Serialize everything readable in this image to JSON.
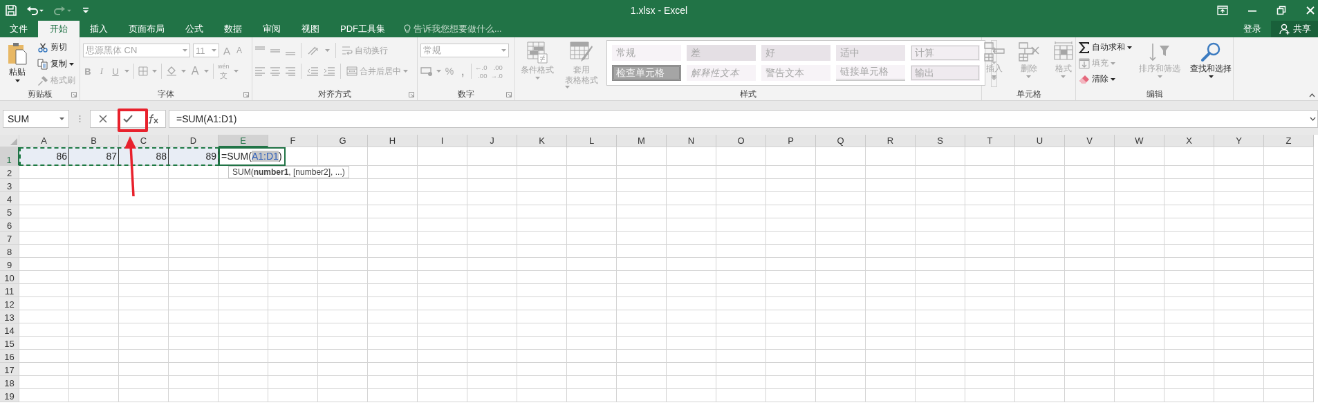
{
  "quick_access": [
    {
      "kind": "save",
      "disabled": false
    },
    {
      "kind": "undo",
      "disabled": false
    },
    {
      "kind": "redo",
      "disabled": true
    },
    {
      "kind": "customize",
      "disabled": false
    }
  ],
  "window": {
    "title": "1.xlsx - Excel"
  },
  "window_controls": [
    {
      "kind": "ribbon-options"
    },
    {
      "kind": "minimize"
    },
    {
      "kind": "restore"
    },
    {
      "kind": "close"
    }
  ],
  "tabs": [
    {
      "label": "文件",
      "selected": false
    },
    {
      "label": "开始",
      "selected": true
    },
    {
      "label": "插入",
      "selected": false
    },
    {
      "label": "页面布局",
      "selected": false
    },
    {
      "label": "公式",
      "selected": false
    },
    {
      "label": "数据",
      "selected": false
    },
    {
      "label": "审阅",
      "selected": false
    },
    {
      "label": "视图",
      "selected": false
    },
    {
      "label": "PDF工具集",
      "selected": false
    }
  ],
  "tell_me": {
    "placeholder": "告诉我您想要做什么..."
  },
  "account": {
    "sign_in": "登录",
    "share": "共享"
  },
  "ribbon": {
    "clipboard": {
      "label": "剪贴板",
      "paste": {
        "label": "粘贴",
        "disabled": false
      },
      "items": [
        {
          "kind": "cut",
          "label": "剪切",
          "disabled": false
        },
        {
          "kind": "copy",
          "label": "复制",
          "disabled": false
        },
        {
          "kind": "format-painter",
          "label": "格式刷",
          "disabled": true
        }
      ]
    },
    "font": {
      "label": "字体",
      "disabled": true,
      "font_name": "思源黑体 CN",
      "font_size": "11",
      "grow": "A",
      "shrink": "A",
      "bold": "B",
      "italic": "I",
      "underline": "U",
      "font_color": "A",
      "phonetic": [
        "wén",
        "文"
      ]
    },
    "alignment": {
      "label": "对齐方式",
      "disabled": true,
      "wrap_text": "自动换行",
      "merge_center": "合并后居中"
    },
    "number": {
      "label": "数字",
      "disabled": true,
      "format": "常规",
      "percent": "%",
      "comma": ",",
      "increase_decimal": [
        "←.0",
        ".00"
      ],
      "decrease_decimal": [
        ".00",
        "→.0"
      ]
    },
    "styles": {
      "label": "样式",
      "disabled": true,
      "conditional_formatting": "条件格式",
      "format_as_table": [
        "套用",
        "表格格式"
      ],
      "gallery": [
        {
          "label": "常规",
          "kind": "plain",
          "color": "#f7f3f7"
        },
        {
          "label": "差",
          "kind": "plain",
          "color": "#e4dfe4"
        },
        {
          "label": "好",
          "kind": "plain",
          "color": "#e8e3e8"
        },
        {
          "label": "适中",
          "kind": "plain",
          "color": "#ebe6eb"
        },
        {
          "label": "计算",
          "kind": "boxed",
          "color": "#f2eef2"
        },
        {
          "label": "检查单元格",
          "kind": "check",
          "color": "#a5a5a5"
        },
        {
          "label": "解释性文本",
          "kind": "italic",
          "color": "#f7f3f7"
        },
        {
          "label": "警告文本",
          "kind": "plain",
          "color": "#f7f3f7"
        },
        {
          "label": "链接单元格",
          "kind": "underline",
          "color": "#f7f3f7"
        },
        {
          "label": "输出",
          "kind": "boxed",
          "color": "#efeaef"
        }
      ]
    },
    "cells": {
      "label": "单元格",
      "disabled": true,
      "items": [
        {
          "kind": "insert",
          "label": "插入"
        },
        {
          "kind": "delete",
          "label": "删除"
        },
        {
          "kind": "format",
          "label": "格式"
        }
      ]
    },
    "editing": {
      "label": "编辑",
      "items": [
        {
          "kind": "autosum",
          "label": "自动求和",
          "disabled": false
        },
        {
          "kind": "fill",
          "label": "填充",
          "disabled": true
        },
        {
          "kind": "clear",
          "label": "清除",
          "disabled": false
        },
        {
          "kind": "sort-filter",
          "label": "排序和筛选",
          "disabled": true
        },
        {
          "kind": "find-select",
          "label": "查找和选择",
          "disabled": false
        }
      ]
    }
  },
  "formula_bar": {
    "name_box": "SUM",
    "formula": "=SUM(A1:D1)"
  },
  "sheet": {
    "columns": [
      {
        "label": "A",
        "selected": false
      },
      {
        "label": "B",
        "selected": false
      },
      {
        "label": "C",
        "selected": false
      },
      {
        "label": "D",
        "selected": false
      },
      {
        "label": "E",
        "selected": true
      },
      {
        "label": "F",
        "selected": false
      },
      {
        "label": "G",
        "selected": false
      },
      {
        "label": "H",
        "selected": false
      },
      {
        "label": "I",
        "selected": false
      },
      {
        "label": "J",
        "selected": false
      },
      {
        "label": "K",
        "selected": false
      },
      {
        "label": "L",
        "selected": false
      },
      {
        "label": "M",
        "selected": false
      },
      {
        "label": "N",
        "selected": false
      },
      {
        "label": "O",
        "selected": false
      },
      {
        "label": "P",
        "selected": false
      },
      {
        "label": "Q",
        "selected": false
      },
      {
        "label": "R",
        "selected": false
      },
      {
        "label": "S",
        "selected": false
      },
      {
        "label": "T",
        "selected": false
      },
      {
        "label": "U",
        "selected": false
      },
      {
        "label": "V",
        "selected": false
      },
      {
        "label": "W",
        "selected": false
      },
      {
        "label": "X",
        "selected": false
      },
      {
        "label": "Y",
        "selected": false
      },
      {
        "label": "Z",
        "selected": false
      }
    ],
    "rows": [
      {
        "label": "1",
        "selected": true
      },
      {
        "label": "2",
        "selected": false
      },
      {
        "label": "3",
        "selected": false
      },
      {
        "label": "4",
        "selected": false
      },
      {
        "label": "5",
        "selected": false
      },
      {
        "label": "6",
        "selected": false
      },
      {
        "label": "7",
        "selected": false
      },
      {
        "label": "8",
        "selected": false
      },
      {
        "label": "9",
        "selected": false
      },
      {
        "label": "10",
        "selected": false
      },
      {
        "label": "11",
        "selected": false
      },
      {
        "label": "12",
        "selected": false
      },
      {
        "label": "13",
        "selected": false
      },
      {
        "label": "14",
        "selected": false
      },
      {
        "label": "15",
        "selected": false
      },
      {
        "label": "16",
        "selected": false
      },
      {
        "label": "17",
        "selected": false
      },
      {
        "label": "18",
        "selected": false
      },
      {
        "label": "19",
        "selected": false
      }
    ],
    "values": [
      "86",
      "87",
      "88",
      "89"
    ],
    "editing_cell": {
      "prefix": "=SUM(",
      "reference": "A1:D1",
      "suffix": ")"
    },
    "tooltip": "SUM(**number1**, [number2], ...)"
  }
}
